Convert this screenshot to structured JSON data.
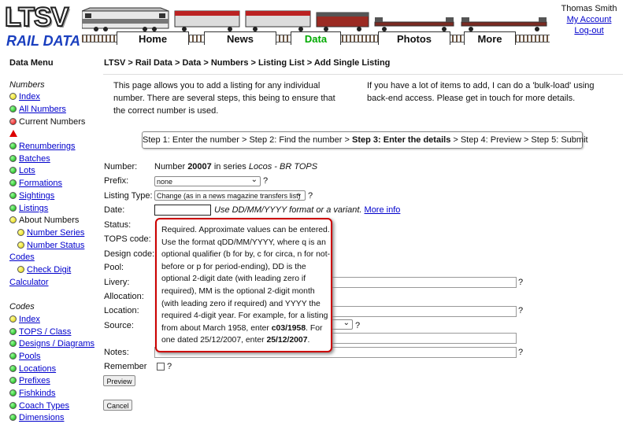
{
  "header": {
    "logo_top": "LTSV",
    "logo_bottom": "RAIL DATA",
    "tabs": [
      {
        "label": "Home"
      },
      {
        "label": "News"
      },
      {
        "label": "Data"
      },
      {
        "label": "Photos"
      },
      {
        "label": "More"
      }
    ],
    "active_tab": "Data",
    "user_name": "Thomas Smith",
    "my_account": "My Account",
    "logout": "Log-out"
  },
  "sidebar": {
    "title": "Data Menu",
    "numbers_heading": "Numbers",
    "numbers_items": [
      {
        "label": "Index",
        "dot": "yellow",
        "link": true
      },
      {
        "label": "All Numbers",
        "dot": "green",
        "link": true
      },
      {
        "label": "Current Numbers",
        "dot": "red",
        "link": false
      },
      {
        "label": "",
        "dot": "warning",
        "link": true
      },
      {
        "label": "Renumberings",
        "dot": "green",
        "link": true
      },
      {
        "label": "Batches",
        "dot": "green",
        "link": true
      },
      {
        "label": "Lots",
        "dot": "green",
        "link": true
      },
      {
        "label": "Formations",
        "dot": "green",
        "link": true
      },
      {
        "label": "Sightings",
        "dot": "green",
        "link": true
      },
      {
        "label": "Listings",
        "dot": "green",
        "link": true
      },
      {
        "label": "About Numbers",
        "dot": "yellow",
        "link": false
      },
      {
        "label": "Number Series",
        "dot": "yellow",
        "link": true,
        "sub": true
      },
      {
        "label": "Number Status",
        "dot": "yellow",
        "link": true,
        "sub": true
      },
      {
        "label": "Codes",
        "dot": "",
        "link": true
      },
      {
        "label": "Check Digit",
        "dot": "yellow",
        "link": true,
        "sub": true
      },
      {
        "label": "Calculator",
        "dot": "",
        "link": true
      }
    ],
    "codes_heading": "Codes",
    "codes_items": [
      {
        "label": "Index",
        "dot": "yellow"
      },
      {
        "label": "TOPS / Class",
        "dot": "green"
      },
      {
        "label": "Designs / Diagrams",
        "dot": "green"
      },
      {
        "label": "Pools",
        "dot": "green"
      },
      {
        "label": "Locations",
        "dot": "green"
      },
      {
        "label": "Prefixes",
        "dot": "green"
      },
      {
        "label": "Fishkinds",
        "dot": "green"
      },
      {
        "label": "Coach Types",
        "dot": "green"
      },
      {
        "label": "Dimensions",
        "dot": "green"
      }
    ]
  },
  "main": {
    "breadcrumb": "LTSV > Rail Data > Data > Numbers > Listing List > Add Single Listing",
    "intro_left": "This page allows you to add a listing for any individual number. There are several steps, this being to ensure that the correct number is used.",
    "intro_right": "If you have a lot of items to add, I can do a 'bulk-load' using back-end access. Please get in touch for more details.",
    "steps": {
      "before": "Step 1: Enter the number > Step 2: Find the number > ",
      "current": "Step 3: Enter the details",
      "after": " > Step 4: Preview > Step 5: Submit"
    },
    "form": {
      "number_label": "Number:",
      "number_prefix": "Number ",
      "number_value": "20007",
      "number_series_text": " in series ",
      "number_series": "Locos - BR TOPS",
      "prefix_label": "Prefix:",
      "prefix_value": "none",
      "listing_type_label": "Listing Type:",
      "listing_type_value": "Change (as in a news magazine transfers list)",
      "date_label": "Date:",
      "date_value": "",
      "date_hint": "Use DD/MM/YYYY format or a variant.",
      "more_info": "More info",
      "status_label": "Status:",
      "tops_code_label": "TOPS code:",
      "design_code_label": "Design code:",
      "pool_label": "Pool:",
      "livery_label": "Livery:",
      "allocation_label": "Allocation:",
      "location_label": "Location:",
      "source_label": "Source:",
      "notes_label": "Notes:",
      "remember_label": "Remember",
      "question_mark": "?",
      "preview_button": "Preview",
      "cancel_button": "Cancel"
    }
  },
  "tooltip": {
    "text_1": "Required. Approximate values can be entered. Use the format qDD/MM/YYYY, where q is an optional qualifier (b for by, c for circa, n for not-before or p for period-ending), DD is the optional 2-digit date (with leading zero if required), MM is the optional 2-digit month (with leading zero if required) and YYYY the required 4-digit year. For example, for a listing from about March 1958, enter ",
    "example_1": "c03/1958",
    "text_2": ". For one dated 25/12/2007, enter ",
    "example_2": "25/12/2007",
    "text_3": "."
  }
}
